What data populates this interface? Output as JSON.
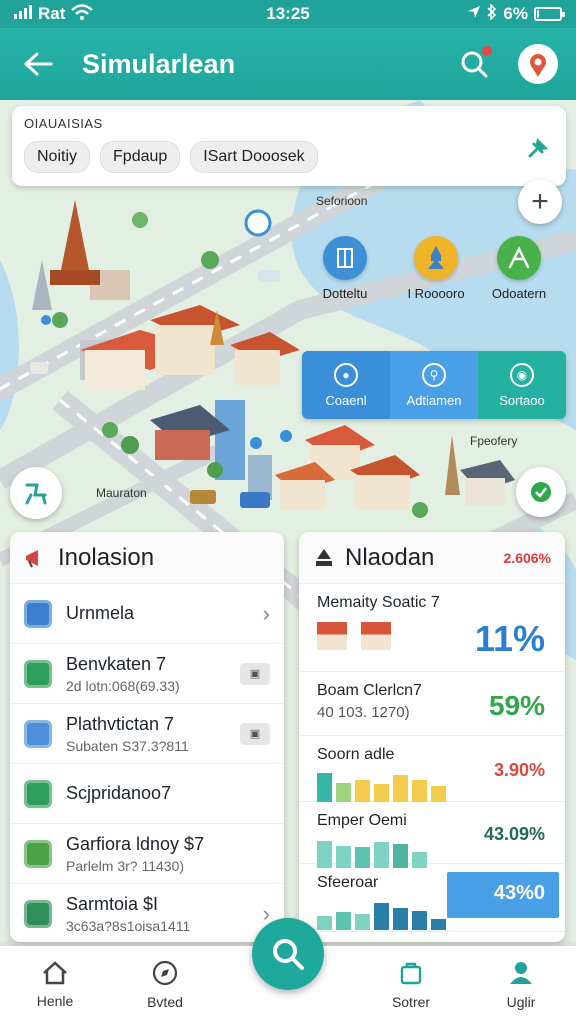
{
  "status_bar": {
    "carrier": "Rat",
    "time": "13:25",
    "battery": "6%",
    "battery_level": 0.06
  },
  "header": {
    "title": "Simularlean"
  },
  "filters": {
    "label": "OIAUAISIAS",
    "chips": [
      "Noitiy",
      "Fpdaup",
      "ISart Dooosek"
    ]
  },
  "map": {
    "pois": [
      {
        "label": "Dotteltu",
        "color": "#3d8fd6"
      },
      {
        "label": "I Rooooro",
        "color": "#f0b429"
      },
      {
        "label": "Odoatern",
        "color": "#48b14a"
      }
    ],
    "modes": [
      {
        "label": "Coaenl",
        "color": "#3a8fd8"
      },
      {
        "label": "Adtiamen",
        "color": "#4aa0e6"
      },
      {
        "label": "Sortaoo",
        "color": "#25b1a1"
      }
    ],
    "labels": {
      "top": "Seforioon",
      "right": "Fpeofery",
      "left": "Mauraton"
    }
  },
  "left_panel": {
    "title": "Inolasion",
    "items": [
      {
        "title": "Urnmela",
        "subtitle": "",
        "icon": "document-blue-icon",
        "color": "#3a7fd0",
        "trail": "chevron"
      },
      {
        "title": "Benvkaten 7",
        "subtitle": "2d lotn:068(69.33)",
        "icon": "box-green-icon",
        "color": "#2e9e5b",
        "trail": "tag"
      },
      {
        "title": "Plathvtictan 7",
        "subtitle": "Subaten S37.3?811",
        "icon": "tray-blue-icon",
        "color": "#4a8fd8",
        "trail": "tag"
      },
      {
        "title": "Scjpridanoo7",
        "subtitle": "",
        "icon": "leaf-green-icon",
        "color": "#2e9e5b",
        "trail": ""
      },
      {
        "title": "Garfiora ldnoy $7",
        "subtitle": "Parlelm 3r? 11430)",
        "icon": "hex-green-icon",
        "color": "#4ea34a",
        "trail": ""
      },
      {
        "title": "Sarmtoia $I",
        "subtitle": "3c63a?8s1oisa1411",
        "icon": "doc-green-icon",
        "color": "#2f8f5a",
        "trail": "chevron"
      }
    ]
  },
  "right_panel": {
    "title": "Nlaodan",
    "percent": "2.606%",
    "stats": [
      {
        "title": "Memaity Soatic 7",
        "subtitle": "",
        "value": "11%",
        "color": "#2c7fd0"
      },
      {
        "title": "Boam Clerlcn7",
        "subtitle": "40 103. 1270)",
        "value": "59%",
        "color": "#2ea84a"
      },
      {
        "title": "Soorn adle",
        "subtitle": "",
        "value": "3.90%",
        "color": "#d64a3a",
        "bars": [
          0.9,
          0.6,
          0.7,
          0.55,
          0.85,
          0.7,
          0.5
        ],
        "bar_colors": [
          "#37b5a6",
          "#9fd27c",
          "#f2cc4a",
          "#f2cc4a",
          "#f2cc4a",
          "#f2cc4a",
          "#f2cc4a"
        ]
      },
      {
        "title": "Emper Oemi",
        "subtitle": "",
        "value": "43.09%",
        "color": "#1f6b5a",
        "bars": [
          0.85,
          0.7,
          0.65,
          0.8,
          0.75,
          0.5
        ],
        "bar_colors": [
          "#7fd3c2",
          "#7fd3c2",
          "#5ec2ae",
          "#7fd3c2",
          "#4fb6a2",
          "#7fd3c2"
        ]
      },
      {
        "title": "Sfeeroar",
        "subtitle": "",
        "value": "43%0",
        "color": "#ffffff",
        "bars": [
          0.45,
          0.55,
          0.5,
          0.85,
          0.7,
          0.6,
          0.35
        ],
        "bar_colors": [
          "#7fd3c2",
          "#5ec2ae",
          "#7fd3c2",
          "#2a7fa8",
          "#2a7fa8",
          "#2a7fa8",
          "#2a7fa8"
        ]
      }
    ]
  },
  "bottom_nav": {
    "items": [
      {
        "label": "Henle",
        "icon": "home-icon"
      },
      {
        "label": "Bvted",
        "icon": "compass-icon"
      },
      {
        "label": "Sotrer",
        "icon": "bag-icon"
      },
      {
        "label": "Uglir",
        "icon": "user-icon"
      }
    ]
  },
  "colors": {
    "primary": "#1fa39a",
    "accent": "#25b1a1"
  }
}
